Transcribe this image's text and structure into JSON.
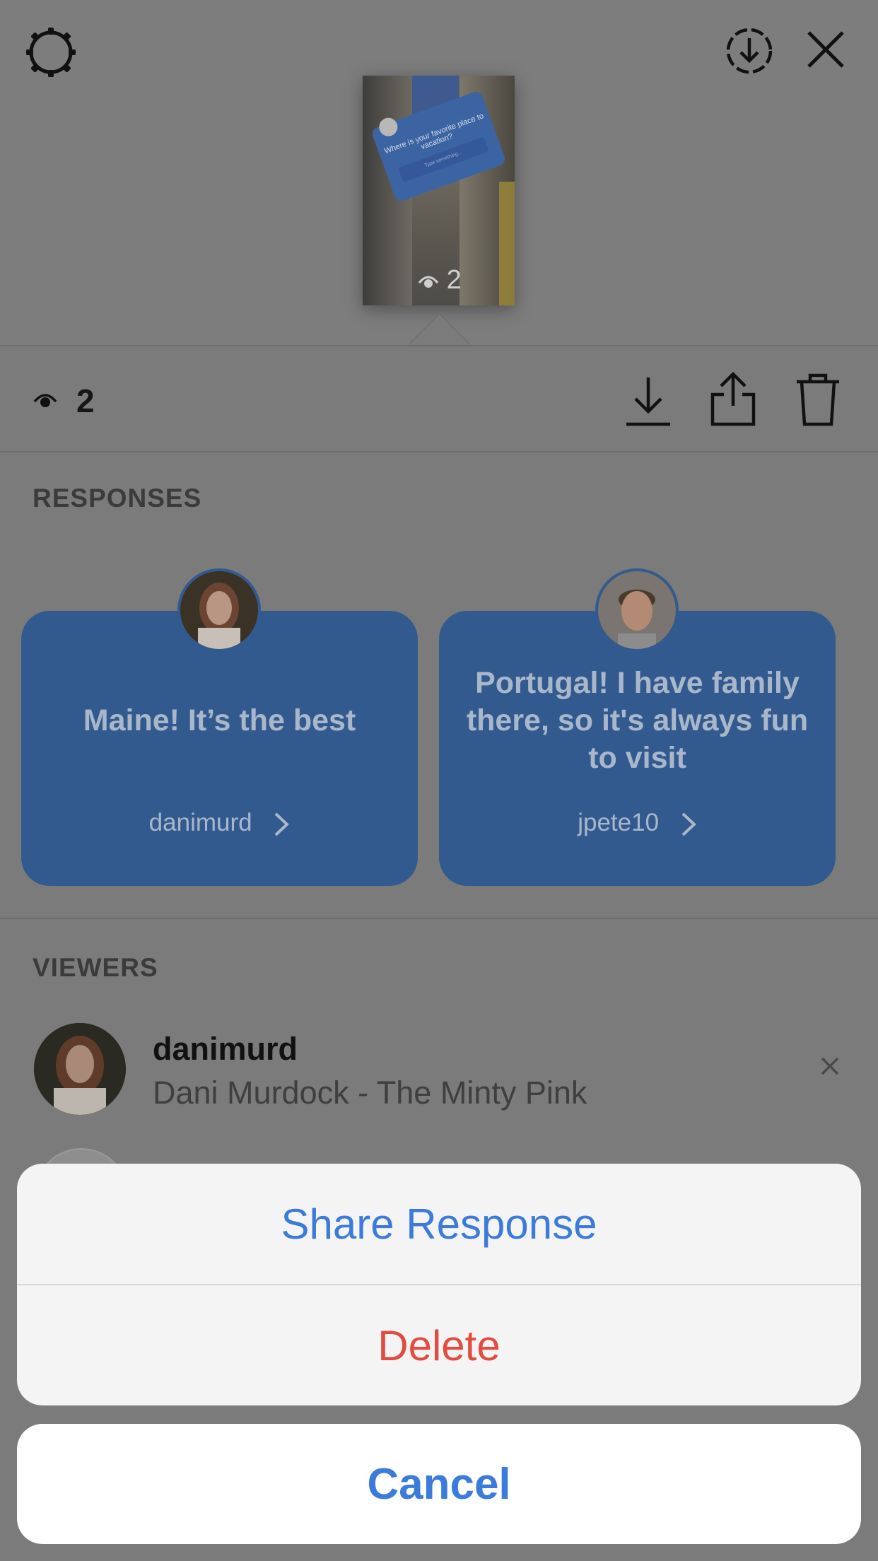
{
  "story": {
    "thumbnail_view_count": "2",
    "thumbnail_question": "Where is your favorite place to vacation?",
    "thumbnail_placeholder": "Type something..."
  },
  "stats": {
    "view_count": "2"
  },
  "responses": {
    "label": "RESPONSES",
    "items": [
      {
        "text": "Maine! It’s the best",
        "username": "danimurd"
      },
      {
        "text": "Portugal! I have family there, so it's always fun to visit",
        "username": "jpete10"
      }
    ]
  },
  "viewers": {
    "label": "VIEWERS",
    "items": [
      {
        "username": "danimurd",
        "full_name": "Dani Murdock - The Minty Pink"
      }
    ]
  },
  "action_sheet": {
    "share_label": "Share Response",
    "delete_label": "Delete",
    "cancel_label": "Cancel"
  },
  "colors": {
    "ios_blue": "#3b7bdc",
    "destructive_red": "#e34b3f",
    "response_card": "#335a8f"
  },
  "icons": [
    "settings-gear-icon",
    "download-circle-icon",
    "close-icon",
    "eye-icon",
    "download-icon",
    "share-icon",
    "trash-icon",
    "chevron-right-icon",
    "dismiss-x-icon"
  ]
}
